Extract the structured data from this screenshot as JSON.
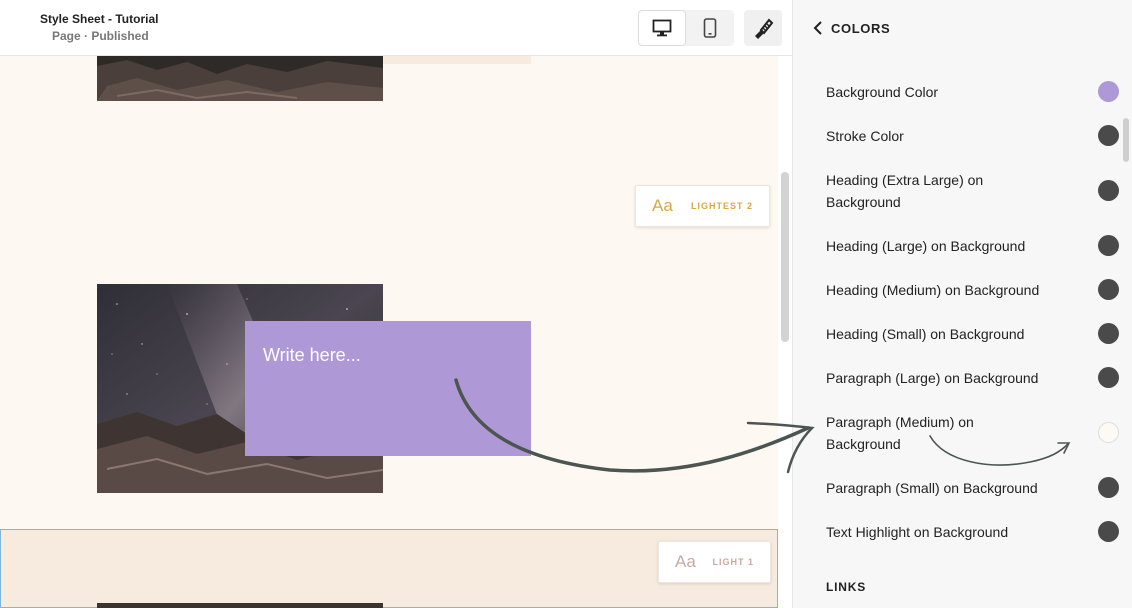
{
  "header": {
    "site_title": "Style Sheet - Tutorial",
    "site_status": "Page · Published"
  },
  "toolbar": {
    "desktop_view_icon": "monitor-icon",
    "mobile_view_icon": "phone-icon",
    "site_styles_icon": "paintbrush-icon"
  },
  "canvas": {
    "text_block_placeholder": "Write here...",
    "section_theme_1": {
      "aa": "Aa",
      "label": "LIGHTEST 2"
    },
    "section_theme_2": {
      "aa": "Aa",
      "label": "LIGHT 1"
    }
  },
  "panel": {
    "back_icon": "chevron-left-icon",
    "title": "COLORS",
    "items": [
      {
        "label": "Background Color",
        "swatch": "#ae98d6"
      },
      {
        "label": "Stroke Color",
        "swatch": "#4a4a4a"
      },
      {
        "label": "Heading (Extra Large) on Background",
        "swatch": "#4a4a4a"
      },
      {
        "label": "Heading (Large) on Background",
        "swatch": "#4a4a4a"
      },
      {
        "label": "Heading (Medium) on Background",
        "swatch": "#4a4a4a"
      },
      {
        "label": "Heading (Small) on Background",
        "swatch": "#4a4a4a"
      },
      {
        "label": "Paragraph (Large) on Background",
        "swatch": "#4a4a4a"
      },
      {
        "label": "Paragraph (Medium) on Background",
        "swatch": "#fdfaf3"
      },
      {
        "label": "Paragraph (Small) on Background",
        "swatch": "#4a4a4a"
      },
      {
        "label": "Text Highlight on Background",
        "swatch": "#4a4a4a"
      }
    ],
    "links_heading": "LINKS"
  },
  "colors": {
    "canvas_bg": "#fdf9f2",
    "section_peach": "#f7ebe0",
    "accent_purple": "#ae98d6",
    "theme_gold": "#d4a843",
    "theme_rose": "#c9a9a0"
  }
}
